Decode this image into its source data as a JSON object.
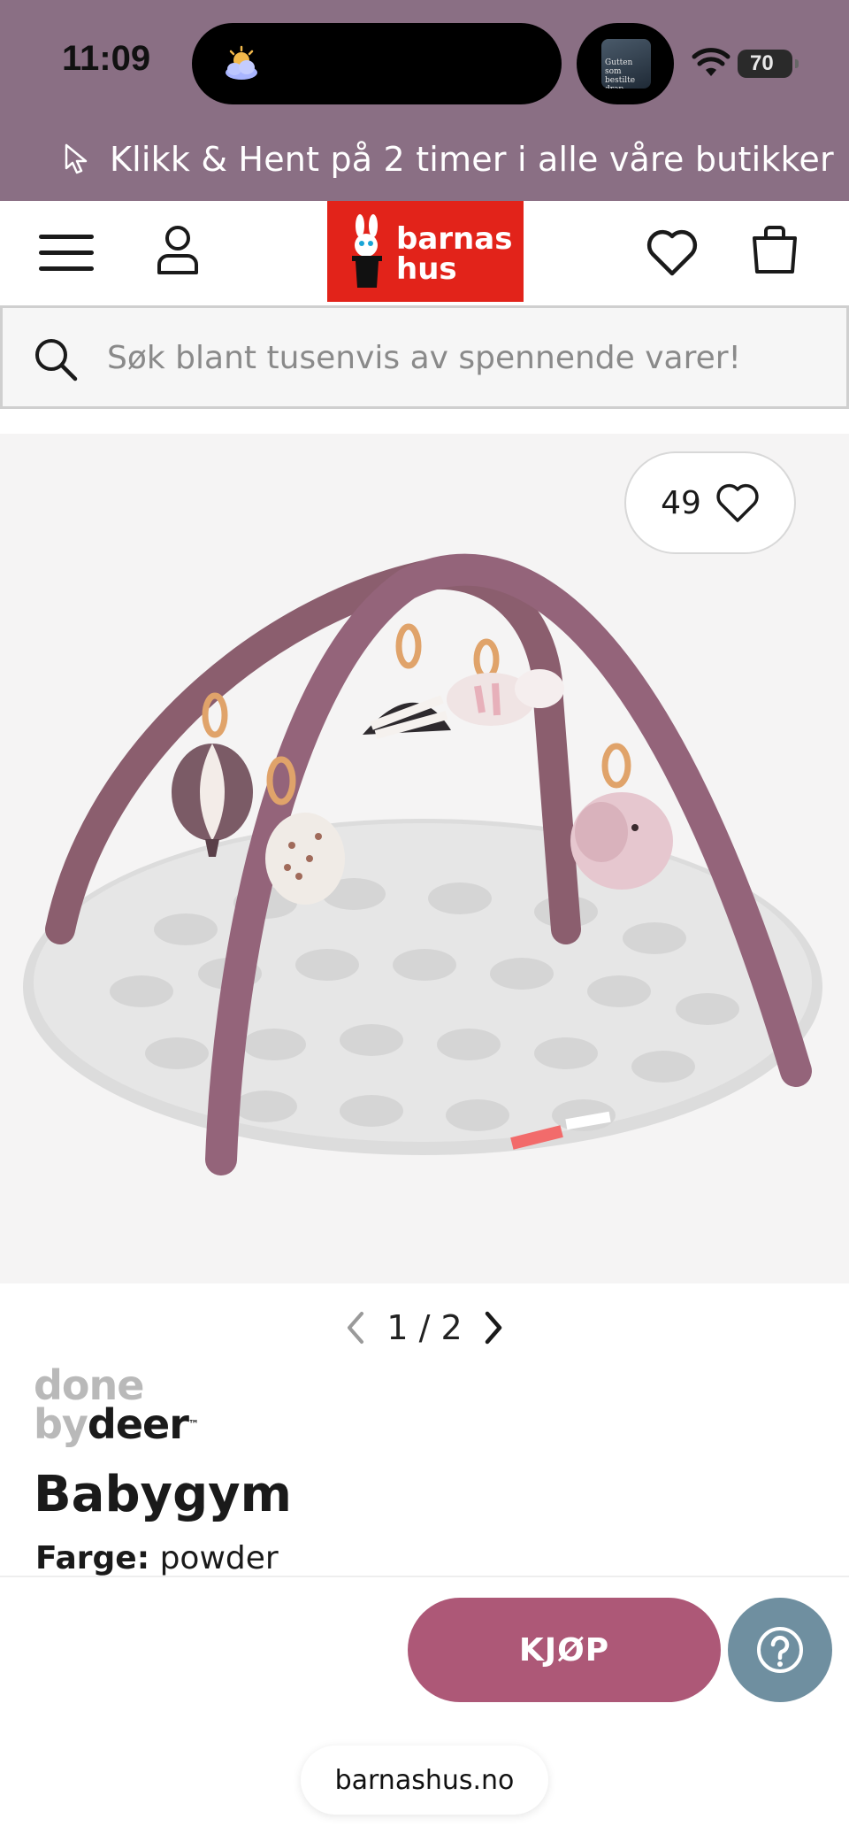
{
  "status_bar": {
    "time": "11:09",
    "battery": "70",
    "now_playing_art_text": "Gutten som bestilte drap"
  },
  "promo": {
    "text": "Klikk & Hent på 2 timer i alle våre butikker",
    "icon": "cursor-icon"
  },
  "header": {
    "logo_line1": "barnas",
    "logo_line2": "hus",
    "logo_color": "#e2231a",
    "icons": [
      "menu-icon",
      "user-icon",
      "heart-icon",
      "bag-icon"
    ]
  },
  "search": {
    "placeholder": "Søk blant tusenvis av spennende varer!"
  },
  "gallery": {
    "favorites_count": "49",
    "page_current": "1",
    "page_separator": "/",
    "page_total": "2"
  },
  "product": {
    "brand_line1": "done",
    "brand_by": "by",
    "brand_deer": "deer",
    "brand_tm": "™",
    "title": "Babygym",
    "color_label": "Farge:",
    "color_value": "powder"
  },
  "actions": {
    "buy_label": "KJØP",
    "buy_color": "#ad5877",
    "help_color": "#6f8fa0"
  },
  "browser": {
    "url": "barnashus.no"
  },
  "colors": {
    "top_bar": "#8a6f84"
  }
}
